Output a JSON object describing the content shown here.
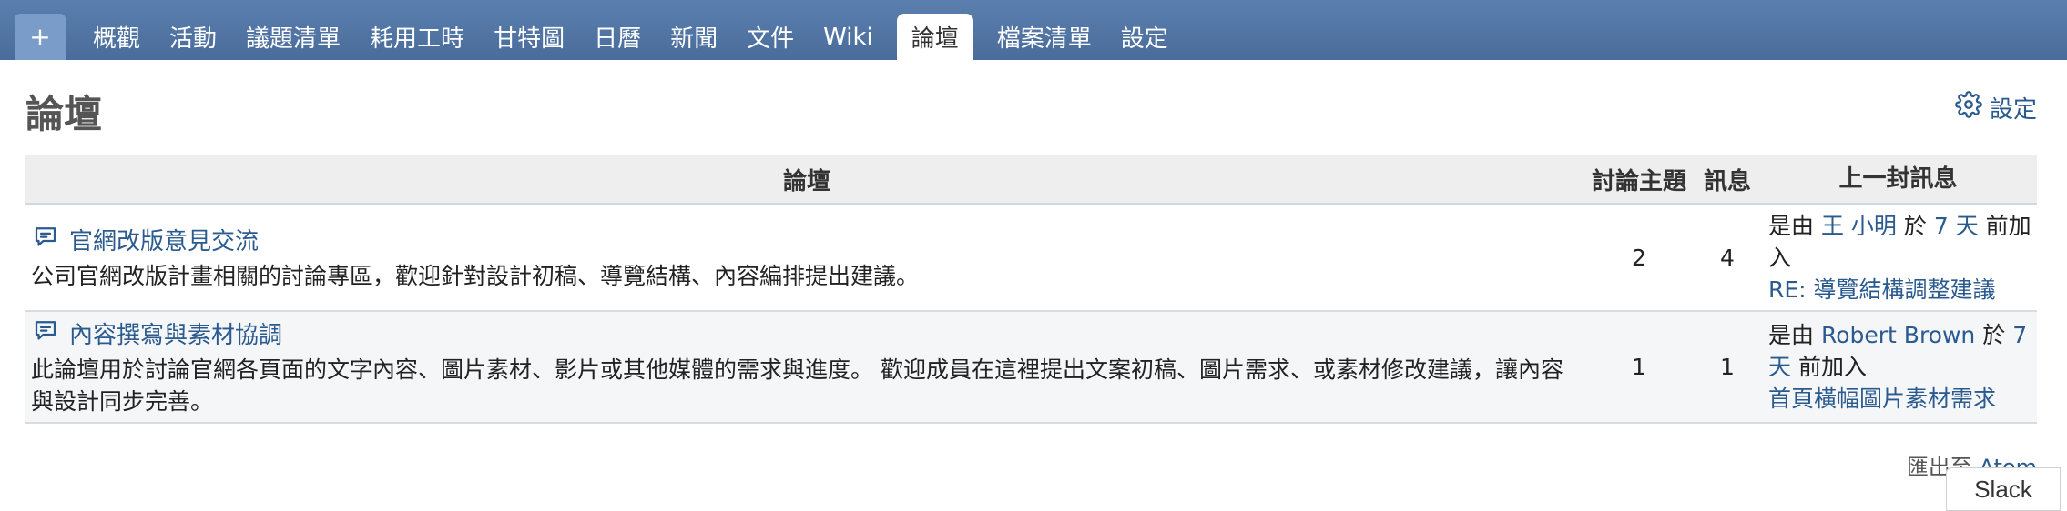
{
  "tabs": [
    {
      "label": "+",
      "name": "tab-new"
    },
    {
      "label": "概觀",
      "name": "tab-overview"
    },
    {
      "label": "活動",
      "name": "tab-activity"
    },
    {
      "label": "議題清單",
      "name": "tab-issues"
    },
    {
      "label": "耗用工時",
      "name": "tab-time"
    },
    {
      "label": "甘特圖",
      "name": "tab-gantt"
    },
    {
      "label": "日曆",
      "name": "tab-calendar"
    },
    {
      "label": "新聞",
      "name": "tab-news"
    },
    {
      "label": "文件",
      "name": "tab-documents"
    },
    {
      "label": "Wiki",
      "name": "tab-wiki"
    },
    {
      "label": "論壇",
      "name": "tab-forums"
    },
    {
      "label": "檔案清單",
      "name": "tab-files"
    },
    {
      "label": "設定",
      "name": "tab-settings"
    }
  ],
  "page": {
    "title": "論壇",
    "settings_label": "設定"
  },
  "table": {
    "headers": {
      "forum": "論壇",
      "topics": "討論主題",
      "messages": "訊息",
      "last_message": "上一封訊息"
    },
    "rows": [
      {
        "name": "官網改版意見交流",
        "description": "公司官網改版計畫相關的討論專區，歡迎針對設計初稿、導覽結構、內容編排提出建議。",
        "topics": "2",
        "messages": "4",
        "last_prefix": "是由",
        "last_author": "王 小明",
        "last_mid": "於",
        "last_time": "7 天",
        "last_suffix": "前加入",
        "last_subject": "RE: 導覽結構調整建議"
      },
      {
        "name": "內容撰寫與素材協調",
        "description": "此論壇用於討論官網各頁面的文字內容、圖片素材、影片或其他媒體的需求與進度。 歡迎成員在這裡提出文案初稿、圖片需求、或素材修改建議，讓內容與設計同步完善。",
        "topics": "1",
        "messages": "1",
        "last_prefix": "是由",
        "last_author": "Robert Brown",
        "last_mid": "於",
        "last_time": "7 天",
        "last_suffix": "前加入",
        "last_subject": "首頁橫幅圖片素材需求"
      }
    ]
  },
  "footer": {
    "export_label": "匯出至",
    "atom_label": "Atom",
    "slack_label": "Slack"
  },
  "colors": {
    "header_bar": "#4a6c9b",
    "link": "#2a5a8f"
  }
}
